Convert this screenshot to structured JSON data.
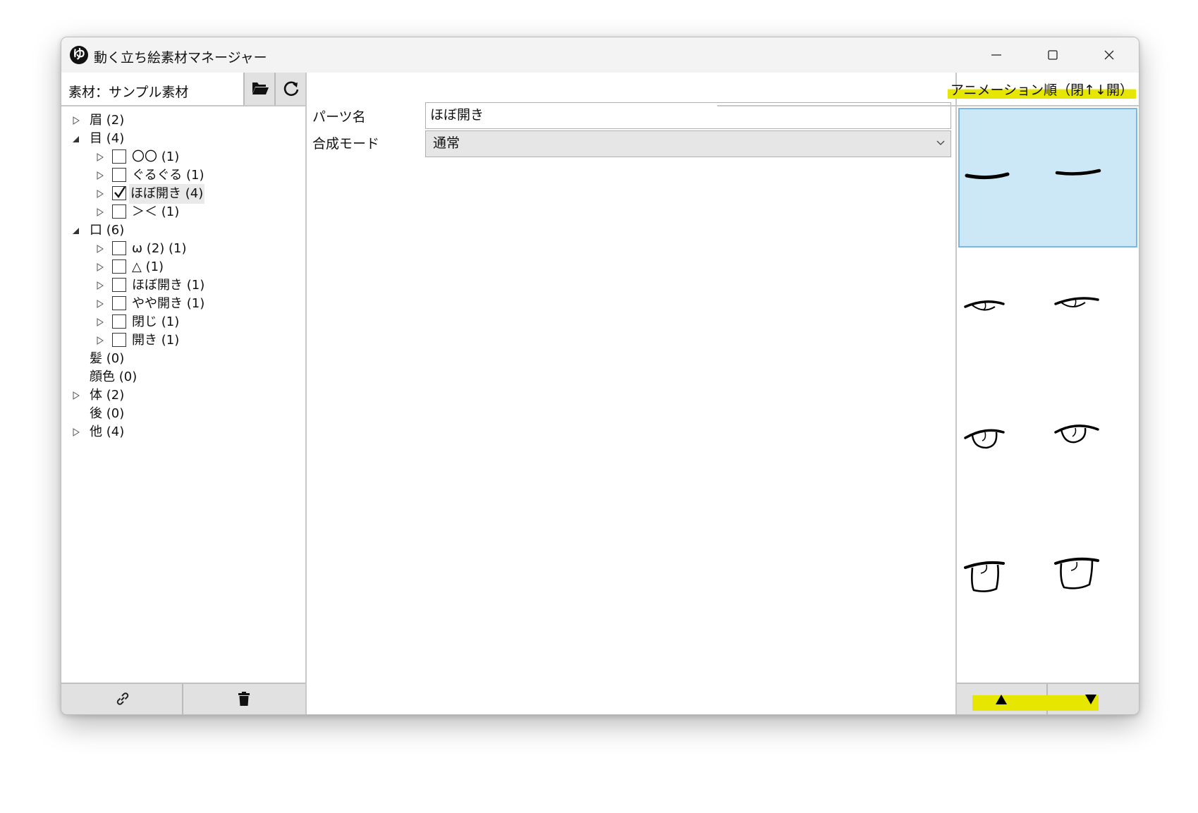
{
  "window": {
    "title": "動く立ち絵素材マネージャー"
  },
  "left": {
    "material_label": "素材：サンプル素材",
    "tree": [
      {
        "label": "眉 (2)",
        "level": 0,
        "expanded": false,
        "has_children": true
      },
      {
        "label": "目 (4)",
        "level": 0,
        "expanded": true,
        "has_children": true
      },
      {
        "label": "〇〇 (1)",
        "level": 1,
        "checked": false,
        "has_children": true
      },
      {
        "label": "ぐるぐる (1)",
        "level": 1,
        "checked": false,
        "has_children": true
      },
      {
        "label": "ほぼ開き (4)",
        "level": 1,
        "checked": true,
        "selected": true,
        "has_children": true
      },
      {
        "label": "＞＜ (1)",
        "level": 1,
        "checked": false,
        "has_children": true
      },
      {
        "label": "口 (6)",
        "level": 0,
        "expanded": true,
        "has_children": true
      },
      {
        "label": "ω (2) (1)",
        "level": 1,
        "checked": false,
        "has_children": true
      },
      {
        "label": "△ (1)",
        "level": 1,
        "checked": false,
        "has_children": true
      },
      {
        "label": "ほぼ開き (1)",
        "level": 1,
        "checked": false,
        "has_children": true
      },
      {
        "label": "やや開き (1)",
        "level": 1,
        "checked": false,
        "has_children": true
      },
      {
        "label": "閉じ (1)",
        "level": 1,
        "checked": false,
        "has_children": true
      },
      {
        "label": "開き (1)",
        "level": 1,
        "checked": false,
        "has_children": true
      },
      {
        "label": "髪 (0)",
        "level": 0,
        "has_children": false
      },
      {
        "label": "顔色 (0)",
        "level": 0,
        "has_children": false
      },
      {
        "label": "体 (2)",
        "level": 0,
        "expanded": false,
        "has_children": true
      },
      {
        "label": "後 (0)",
        "level": 0,
        "has_children": false
      },
      {
        "label": "他 (4)",
        "level": 0,
        "expanded": false,
        "has_children": true
      }
    ]
  },
  "middle": {
    "part_name_label": "パーツ名",
    "part_name_value": "ほぼ開き",
    "blend_mode_label": "合成モード",
    "blend_mode_value": "通常"
  },
  "right": {
    "anim_order_label": "アニメーション順（閉↑↓開）",
    "frames": [
      {
        "kind": "closed",
        "selected": true
      },
      {
        "kind": "slightly-open",
        "selected": false
      },
      {
        "kind": "half-open",
        "selected": false
      },
      {
        "kind": "open",
        "selected": false
      }
    ]
  },
  "colors": {
    "highlight": "#e6e600",
    "selection": "#cce8f6",
    "button_bg": "#e1e1e1"
  },
  "icons": [
    "app-logo-icon",
    "minimize-icon",
    "maximize-icon",
    "close-icon",
    "folder-open-icon",
    "refresh-icon",
    "link-icon",
    "trash-icon",
    "triangle-up-icon",
    "triangle-down-icon"
  ]
}
